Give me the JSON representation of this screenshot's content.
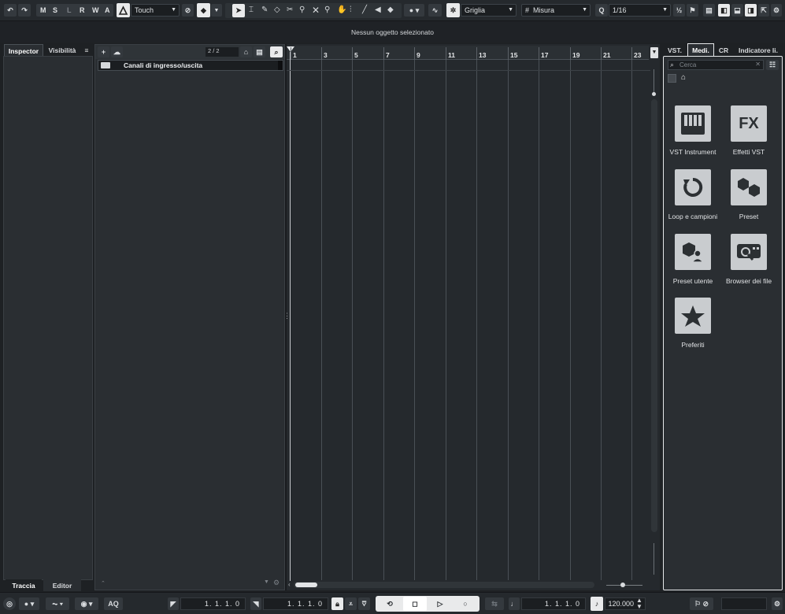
{
  "toolbar": {
    "undo_icon": "undo-icon",
    "redo_icon": "redo-icon",
    "state_buttons": [
      "M",
      "S",
      "L",
      "R",
      "W",
      "A"
    ],
    "automation_mode": "Touch",
    "snap_type": "Griglia",
    "grid_type": "Misura",
    "quantize_value": "1/16"
  },
  "status": {
    "message": "Nessun oggetto selezionato"
  },
  "left_zone": {
    "tabs": [
      "Inspector",
      "Visibilità"
    ],
    "bottom_tabs": [
      "Traccia",
      "Editor"
    ]
  },
  "track_list": {
    "counter": "2 / 2",
    "folder_track_name": "Canali di ingresso/uscita"
  },
  "ruler": {
    "bars": [
      "1",
      "3",
      "5",
      "7",
      "9",
      "11",
      "13",
      "15",
      "17",
      "19",
      "21",
      "23"
    ]
  },
  "right_zone": {
    "tabs": [
      "VST.",
      "Medi.",
      "CR",
      "Indicatore li."
    ],
    "search_placeholder": "Cerca",
    "tiles": [
      {
        "label": "VST Instrument",
        "icon": "piano-keys-icon"
      },
      {
        "label": "Effetti VST",
        "icon": "fx-icon"
      },
      {
        "label": "Loop e campioni",
        "icon": "loop-icon"
      },
      {
        "label": "Preset",
        "icon": "hexagons-icon"
      },
      {
        "label": "Preset utente",
        "icon": "user-preset-icon"
      },
      {
        "label": "Browser dei file",
        "icon": "file-browser-icon"
      },
      {
        "label": "Preferiti",
        "icon": "star-icon"
      }
    ]
  },
  "transport": {
    "quantize_label": "AQ",
    "left_locator": "1. 1. 1.   0",
    "right_locator": "1. 1. 1.   0",
    "primary_time": "1. 1. 1.   0",
    "tempo": "120.000"
  },
  "colors": {
    "background": "#1e2124",
    "panel": "#2a2e32",
    "accent_white": "#e9eaeb"
  }
}
